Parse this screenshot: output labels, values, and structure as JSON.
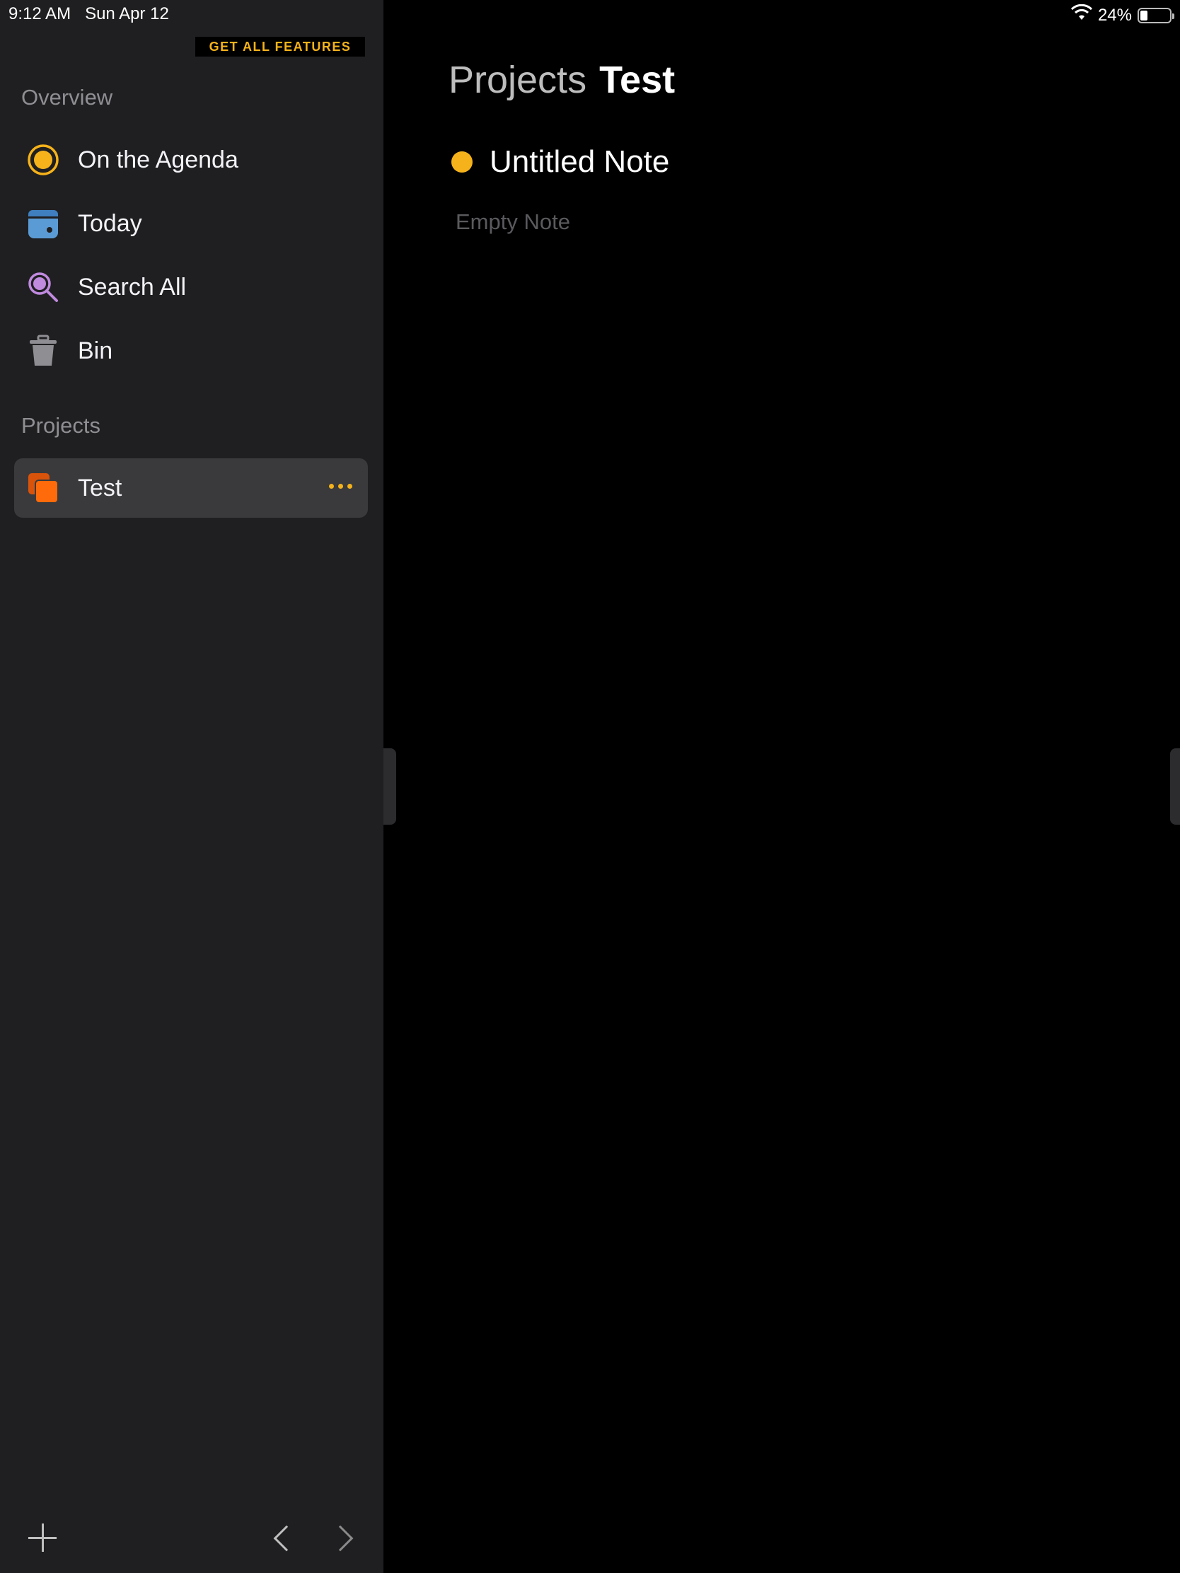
{
  "status_bar": {
    "time": "9:12 AM",
    "date": "Sun Apr 12",
    "battery_percent": "24%",
    "battery_level": 0.24
  },
  "sidebar": {
    "promo_button": "GET ALL FEATURES",
    "overview_label": "Overview",
    "overview_items": [
      {
        "label": "On the Agenda",
        "icon": "agenda-icon",
        "color": "#f5b21a"
      },
      {
        "label": "Today",
        "icon": "calendar-icon",
        "color": "#5b9bd5"
      },
      {
        "label": "Search All",
        "icon": "search-icon",
        "color": "#c08adf"
      },
      {
        "label": "Bin",
        "icon": "trash-icon",
        "color": "#8e8e93"
      }
    ],
    "projects_label": "Projects",
    "projects": [
      {
        "label": "Test",
        "icon": "project-icon",
        "color": "#ff6a0a",
        "selected": true
      }
    ]
  },
  "main": {
    "breadcrumb_parent": "Projects",
    "breadcrumb_current": "Test",
    "notes": [
      {
        "title": "Untitled Note",
        "preview": "Empty Note",
        "dot_color": "#f5b21a"
      }
    ]
  },
  "colors": {
    "accent": "#f5b21a",
    "sidebar_bg": "#1f1f21",
    "main_bg": "#000000",
    "selected_bg": "#3a3a3c"
  }
}
